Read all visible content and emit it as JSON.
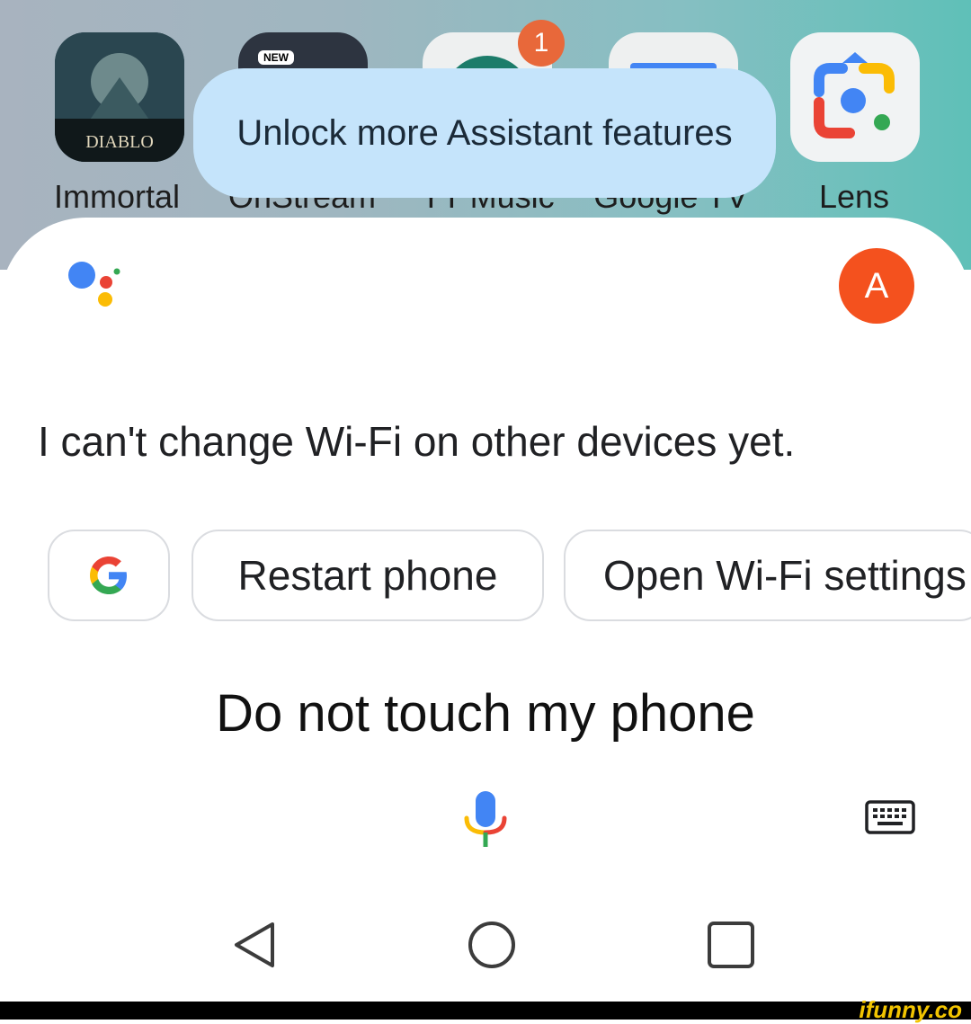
{
  "home_screen": {
    "apps": [
      {
        "label": "Immortal",
        "icon_text": "DIABLO"
      },
      {
        "label": "OnStream",
        "icon_badge": "NEW"
      },
      {
        "label": "YT Music",
        "badge_count": "1"
      },
      {
        "label": "Google TV"
      },
      {
        "label": "Lens"
      }
    ]
  },
  "toast": {
    "text": "Unlock more Assistant features"
  },
  "assistant": {
    "avatar_letter": "A",
    "response": "I can't change Wi-Fi on other devices yet.",
    "suggestions": [
      "Restart phone",
      "Open Wi-Fi settings"
    ],
    "query": "Do not touch my phone"
  },
  "watermark": "ifunny.co",
  "colors": {
    "toast_bg": "#c5e4fb",
    "avatar_bg": "#f4511e",
    "google_blue": "#4285f4",
    "google_red": "#ea4335",
    "google_yellow": "#fbbc05",
    "google_green": "#34a853"
  }
}
